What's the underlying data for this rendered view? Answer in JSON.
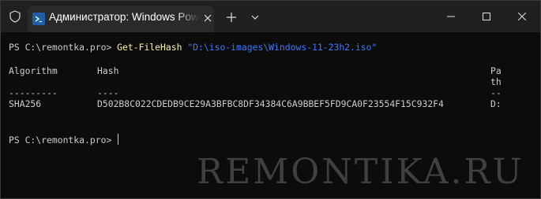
{
  "window": {
    "tab_title": "Администратор: Windows PowerShell"
  },
  "terminal": {
    "prompt1": "PS C:\\remontka.pro> ",
    "command": "Get-FileHash",
    "argument": "\"D:\\iso-images\\Windows-11-23h2.iso\"",
    "headers": {
      "algorithm": "Algorithm",
      "hash": "Hash",
      "path_line1": "Pa",
      "path_line2": "th"
    },
    "underlines": {
      "algorithm": "---------",
      "hash": "----",
      "path": "--"
    },
    "row": {
      "algorithm": "SHA256",
      "hash": "D502B8C022CDEDB9CE29A3BFBC8DF34384C6A9BBEF5FD9CA0F23554F15C932F4",
      "path": "D:"
    },
    "prompt2": "PS C:\\remontka.pro> "
  },
  "watermark": "REMONTIKA.RU",
  "colors": {
    "background": "#0c0c0c",
    "text": "#cccccc",
    "cmdlet": "#f9f1a5",
    "string": "#3b78ff",
    "titlebar": "#202020"
  }
}
